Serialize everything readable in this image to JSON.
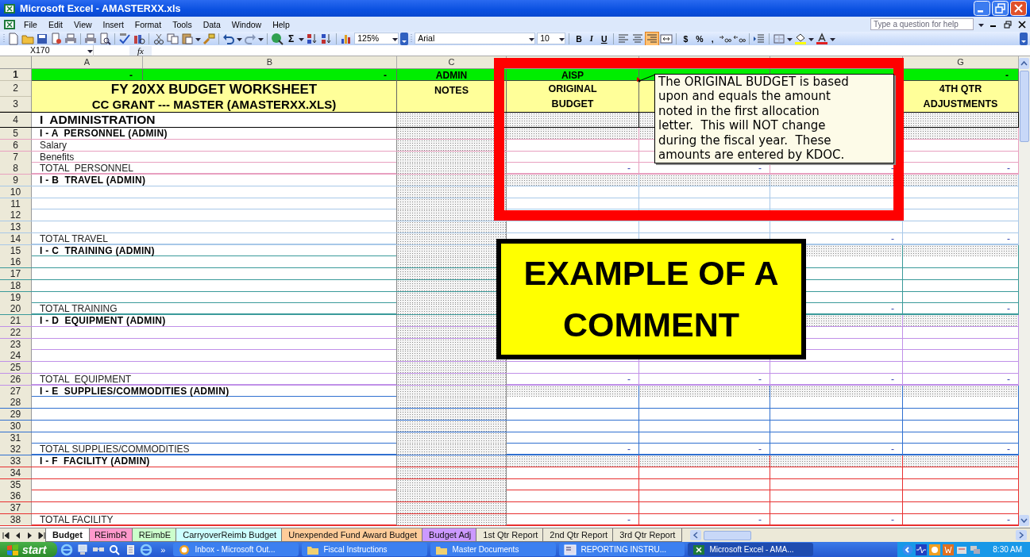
{
  "window": {
    "title": "Microsoft Excel - AMASTERXX.xls"
  },
  "menu": {
    "items": [
      "File",
      "Edit",
      "View",
      "Insert",
      "Format",
      "Tools",
      "Data",
      "Window",
      "Help"
    ],
    "help_placeholder": "Type a question for help"
  },
  "toolbar": {
    "sum": "Σ",
    "zoom": "125%",
    "font": "Arial",
    "size": "10",
    "styles": [
      "B",
      "I",
      "U"
    ],
    "alignment": [
      {
        "selected": false
      },
      {
        "selected": false
      },
      {
        "selected": true
      },
      {
        "selected": false
      }
    ],
    "number_formats": [
      "$",
      "%",
      ","
    ]
  },
  "formula_bar": {
    "name_box": "X170",
    "function_label": "fx"
  },
  "columns": [
    {
      "header": "A"
    },
    {
      "header": "B"
    },
    {
      "header": "C"
    },
    {},
    {},
    {},
    {
      "header": "G"
    }
  ],
  "header_rows": {
    "row1": {
      "numbers": [
        "1"
      ],
      "cells": {
        "column_1": "-",
        "column_2": "-",
        "column_3": "ADMIN",
        "column_4": "AISP",
        "column_7": "-"
      }
    },
    "row23": {
      "numbers": [
        "2",
        "3"
      ],
      "title_lines": [
        "FY 20XX BUDGET WORKSHEET",
        "CC GRANT --- MASTER (AMASTERXX.XLS)"
      ],
      "notes": "NOTES",
      "original_budget": [
        "ORIGINAL",
        "BUDGET"
      ],
      "fourth_quarter": [
        "4TH QTR",
        "ADJUSTMENTS"
      ]
    }
  },
  "sections": [
    {
      "color": "#000000",
      "rows": [
        {
          "number": "4",
          "kind": "major",
          "label": "I  ADMINISTRATION"
        }
      ]
    },
    {
      "color": "#e8a0c0",
      "rows": [
        {
          "number": "5",
          "kind": "section",
          "label": "I - A  PERSONNEL (ADMIN)"
        },
        {
          "number": "6",
          "kind": "item",
          "label": "Salary"
        },
        {
          "number": "7",
          "kind": "item",
          "label": "Benefits"
        },
        {
          "number": "8",
          "kind": "total",
          "label": "TOTAL  PERSONNEL",
          "values": {
            "column_4": "-",
            "column_5": "-",
            "column_6": "-",
            "column_7": "-"
          }
        }
      ]
    },
    {
      "color": "#a8c8e8",
      "rows": [
        {
          "number": "9",
          "kind": "section",
          "label": "I - B  TRAVEL (ADMIN)"
        },
        {
          "number": "10",
          "kind": "item"
        },
        {
          "number": "11",
          "kind": "item"
        },
        {
          "number": "12",
          "kind": "item"
        },
        {
          "number": "13",
          "kind": "item"
        },
        {
          "number": "14",
          "kind": "total",
          "label": "TOTAL TRAVEL",
          "values": {
            "column_6": "-",
            "column_7": "-"
          }
        }
      ]
    },
    {
      "color": "#3a9a9a",
      "rows": [
        {
          "number": "15",
          "kind": "section",
          "label": "I - C  TRAINING (ADMIN)"
        },
        {
          "number": "16",
          "kind": "item"
        },
        {
          "number": "17",
          "kind": "item"
        },
        {
          "number": "18",
          "kind": "item"
        },
        {
          "number": "19",
          "kind": "item"
        },
        {
          "number": "20",
          "kind": "total",
          "label": "TOTAL TRAINING",
          "values": {
            "column_6": "-",
            "column_7": "-"
          }
        }
      ]
    },
    {
      "color": "#c090e8",
      "rows": [
        {
          "number": "21",
          "kind": "section",
          "label": "I - D  EQUIPMENT (ADMIN)"
        },
        {
          "number": "22",
          "kind": "item"
        },
        {
          "number": "23",
          "kind": "item"
        },
        {
          "number": "24",
          "kind": "item"
        },
        {
          "number": "25",
          "kind": "item"
        },
        {
          "number": "26",
          "kind": "total",
          "label": "TOTAL  EQUIPMENT",
          "values": {
            "column_4": "-",
            "column_5": "-",
            "column_6": "-",
            "column_7": "-"
          }
        }
      ]
    },
    {
      "color": "#3070d0",
      "rows": [
        {
          "number": "27",
          "kind": "section",
          "label": "I - E  SUPPLIES/COMMODITIES (ADMIN)"
        },
        {
          "number": "28",
          "kind": "item"
        },
        {
          "number": "29",
          "kind": "item"
        },
        {
          "number": "30",
          "kind": "item"
        },
        {
          "number": "31",
          "kind": "item"
        },
        {
          "number": "32",
          "kind": "total",
          "label": "TOTAL SUPPLIES/COMMODITIES",
          "values": {
            "column_4": "-",
            "column_5": "-",
            "column_6": "-",
            "column_7": "-"
          }
        }
      ]
    },
    {
      "color": "#e83030",
      "rows": [
        {
          "number": "33",
          "kind": "section",
          "label": "I - F  FACILITY (ADMIN)"
        },
        {
          "number": "34",
          "kind": "item"
        },
        {
          "number": "35",
          "kind": "item"
        },
        {
          "number": "36",
          "kind": "item"
        },
        {
          "number": "37",
          "kind": "item"
        },
        {
          "number": "38",
          "kind": "total",
          "label": "TOTAL FACILITY",
          "values": {
            "column_4": "-",
            "column_5": "-",
            "column_6": "-",
            "column_7": "-"
          }
        }
      ]
    }
  ],
  "comment": {
    "lines": [
      "The ORIGINAL BUDGET is based",
      "upon and equals the amount",
      "noted in the first allocation",
      "letter.  This will NOT change",
      "during the fiscal year.  These",
      "amounts are entered by KDOC."
    ]
  },
  "callout": {
    "text": "EXAMPLE OF A COMMENT"
  },
  "sheet_tabs": [
    {
      "label": "Budget",
      "selected": true,
      "color": "#ffffff"
    },
    {
      "label": "REimbR",
      "selected": false,
      "color": "#ff99cc"
    },
    {
      "label": "REimbE",
      "selected": false,
      "color": "#ccffcc"
    },
    {
      "label": "CarryoverReimb Budget",
      "selected": false,
      "color": "#ccffff"
    },
    {
      "label": "Unexpended Fund Award Budget",
      "selected": false,
      "color": "#ffcc99"
    },
    {
      "label": "Budget Adj",
      "selected": false,
      "color": "#cc99ff"
    },
    {
      "label": "1st Qtr Report",
      "selected": false,
      "color": "#ece9d8"
    },
    {
      "label": "2nd Qtr Report",
      "selected": false,
      "color": "#ece9d8"
    },
    {
      "label": "3rd Qtr Report",
      "selected": false,
      "color": "#ece9d8"
    }
  ],
  "taskbar": {
    "start": "start",
    "chevron": "»",
    "tasks": [
      {
        "label": "Inbox - Microsoft Out...",
        "selected": false
      },
      {
        "label": "Fiscal Instructions",
        "selected": false
      },
      {
        "label": "Master Documents",
        "selected": false
      },
      {
        "label": "REPORTING INSTRU...",
        "selected": false
      },
      {
        "label": "Microsoft Excel - AMA...",
        "selected": true
      }
    ],
    "clock": "8:30 AM"
  }
}
